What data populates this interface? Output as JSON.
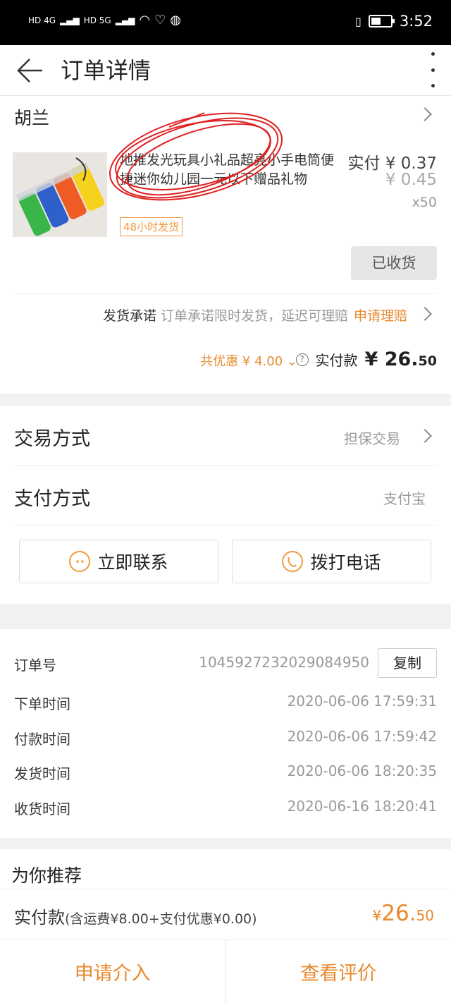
{
  "status_bar": {
    "net1": "HD 4G",
    "net2": "HD 5G",
    "time": "3:52",
    "battery_level": 0.5
  },
  "header": {
    "title": "订单详情"
  },
  "order": {
    "seller": "胡兰",
    "product_title": "地推发光玩具小礼品超亮小手电筒便捷迷你幼儿园一元以下赠品礼物",
    "badge": "48小时发货",
    "paid_price": "实付 ¥ 0.37",
    "original_price": "¥ 0.45",
    "quantity": "x50",
    "received_button": "已收货",
    "promise_label": "发货承诺",
    "promise_text": "订单承诺限时发货，延迟可理赔",
    "promise_action": "申请理赔",
    "discount": "共优惠 ¥ 4.00",
    "total_label": "实付款",
    "total_currency": "¥",
    "total_int": "26.",
    "total_dec": "50"
  },
  "trade": {
    "method_label": "交易方式",
    "method_value": "担保交易",
    "pay_label": "支付方式",
    "pay_value": "支付宝"
  },
  "actions": {
    "contact": "立即联系",
    "call": "拨打电话"
  },
  "info": {
    "order_no_label": "订单号",
    "order_no": "1045927232029084950",
    "copy": "复制",
    "rows": [
      {
        "label": "下单时间",
        "value": "2020-06-06 17:59:31"
      },
      {
        "label": "付款时间",
        "value": "2020-06-06 17:59:42"
      },
      {
        "label": "发货时间",
        "value": "2020-06-06 18:20:35"
      },
      {
        "label": "收货时间",
        "value": "2020-06-16 18:20:41"
      }
    ]
  },
  "recommend": {
    "title": "为你推荐"
  },
  "footer": {
    "label": "实付款",
    "detail": "(含运费¥8.00+支付优惠¥0.00)",
    "currency": "¥",
    "amount_int": "26.",
    "amount_dec": "50"
  },
  "bottom": {
    "intervene": "申请介入",
    "review": "查看评价"
  },
  "colors": {
    "accent": "#e8892c",
    "annotation": "#e02020"
  }
}
